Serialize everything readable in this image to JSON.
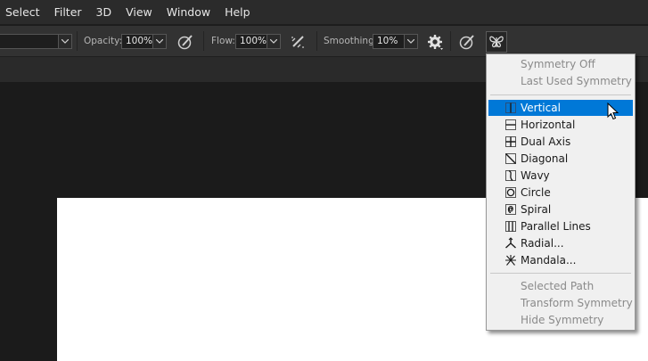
{
  "menubar": {
    "items": [
      "Select",
      "Filter",
      "3D",
      "View",
      "Window",
      "Help"
    ]
  },
  "options": {
    "opacity_label": "Opacity:",
    "opacity_value": "100%",
    "flow_label": "Flow:",
    "flow_value": "100%",
    "smoothing_label": "Smoothing:",
    "smoothing_value": "10%"
  },
  "symmetry_menu": {
    "top_items": [
      {
        "label": "Symmetry Off",
        "enabled": false
      },
      {
        "label": "Last Used Symmetry",
        "enabled": false
      }
    ],
    "modes": [
      {
        "label": "Vertical",
        "icon": "vertical-symmetry-icon",
        "selected": true
      },
      {
        "label": "Horizontal",
        "icon": "horizontal-symmetry-icon"
      },
      {
        "label": "Dual Axis",
        "icon": "dual-axis-icon"
      },
      {
        "label": "Diagonal",
        "icon": "diagonal-icon"
      },
      {
        "label": "Wavy",
        "icon": "wavy-icon"
      },
      {
        "label": "Circle",
        "icon": "circle-icon"
      },
      {
        "label": "Spiral",
        "icon": "spiral-icon"
      },
      {
        "label": "Parallel Lines",
        "icon": "parallel-lines-icon"
      },
      {
        "label": "Radial...",
        "icon": "radial-icon"
      },
      {
        "label": "Mandala...",
        "icon": "mandala-icon"
      }
    ],
    "bottom_items": [
      {
        "label": "Selected Path",
        "enabled": false
      },
      {
        "label": "Transform Symmetry",
        "enabled": false
      },
      {
        "label": "Hide Symmetry",
        "enabled": false
      }
    ],
    "colors": {
      "highlight": "#0078d7",
      "disabled_text": "#8a8a8a"
    }
  }
}
